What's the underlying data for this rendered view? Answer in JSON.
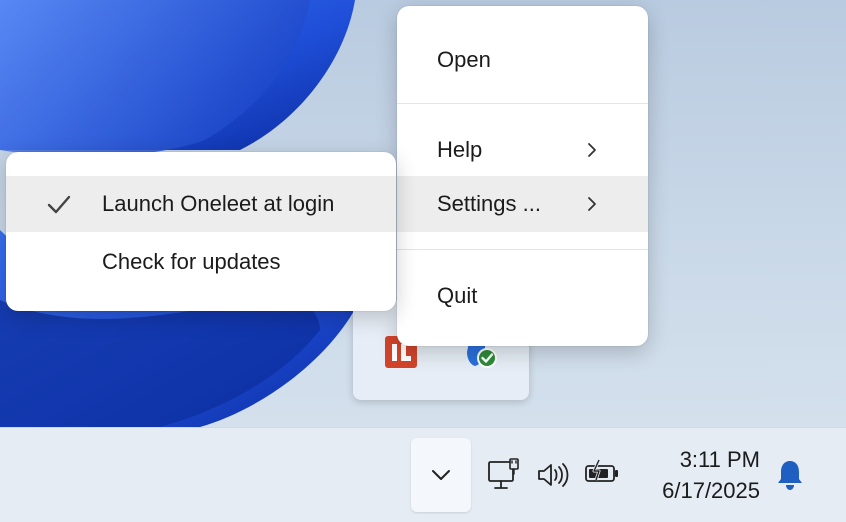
{
  "main_menu": {
    "items": [
      {
        "label": "Open"
      },
      {
        "label": "Help"
      },
      {
        "label": "Settings ..."
      },
      {
        "label": "Quit"
      }
    ]
  },
  "settings_submenu": {
    "items": [
      {
        "label": "Launch Oneleet at login",
        "checked": true
      },
      {
        "label": "Check for updates",
        "checked": false
      }
    ]
  },
  "tray_overflow": {
    "icons": [
      "oneleet-app-icon",
      "security-status-icon"
    ],
    "oneleet_logo_text": "1L"
  },
  "taskbar": {
    "time": "3:11 PM",
    "date": "6/17/2025",
    "icons": [
      "chevron-up-icon",
      "network-icon",
      "volume-icon",
      "battery-icon",
      "notification-bell-icon"
    ]
  },
  "colors": {
    "menu_background": "#ffffff",
    "hover_highlight": "#ededed",
    "oneleet_red": "#d2442b",
    "security_check_green": "#2e8b3a",
    "notification_bell": "#1f5fc2",
    "wallpaper_blue": "#1f4fd8"
  }
}
